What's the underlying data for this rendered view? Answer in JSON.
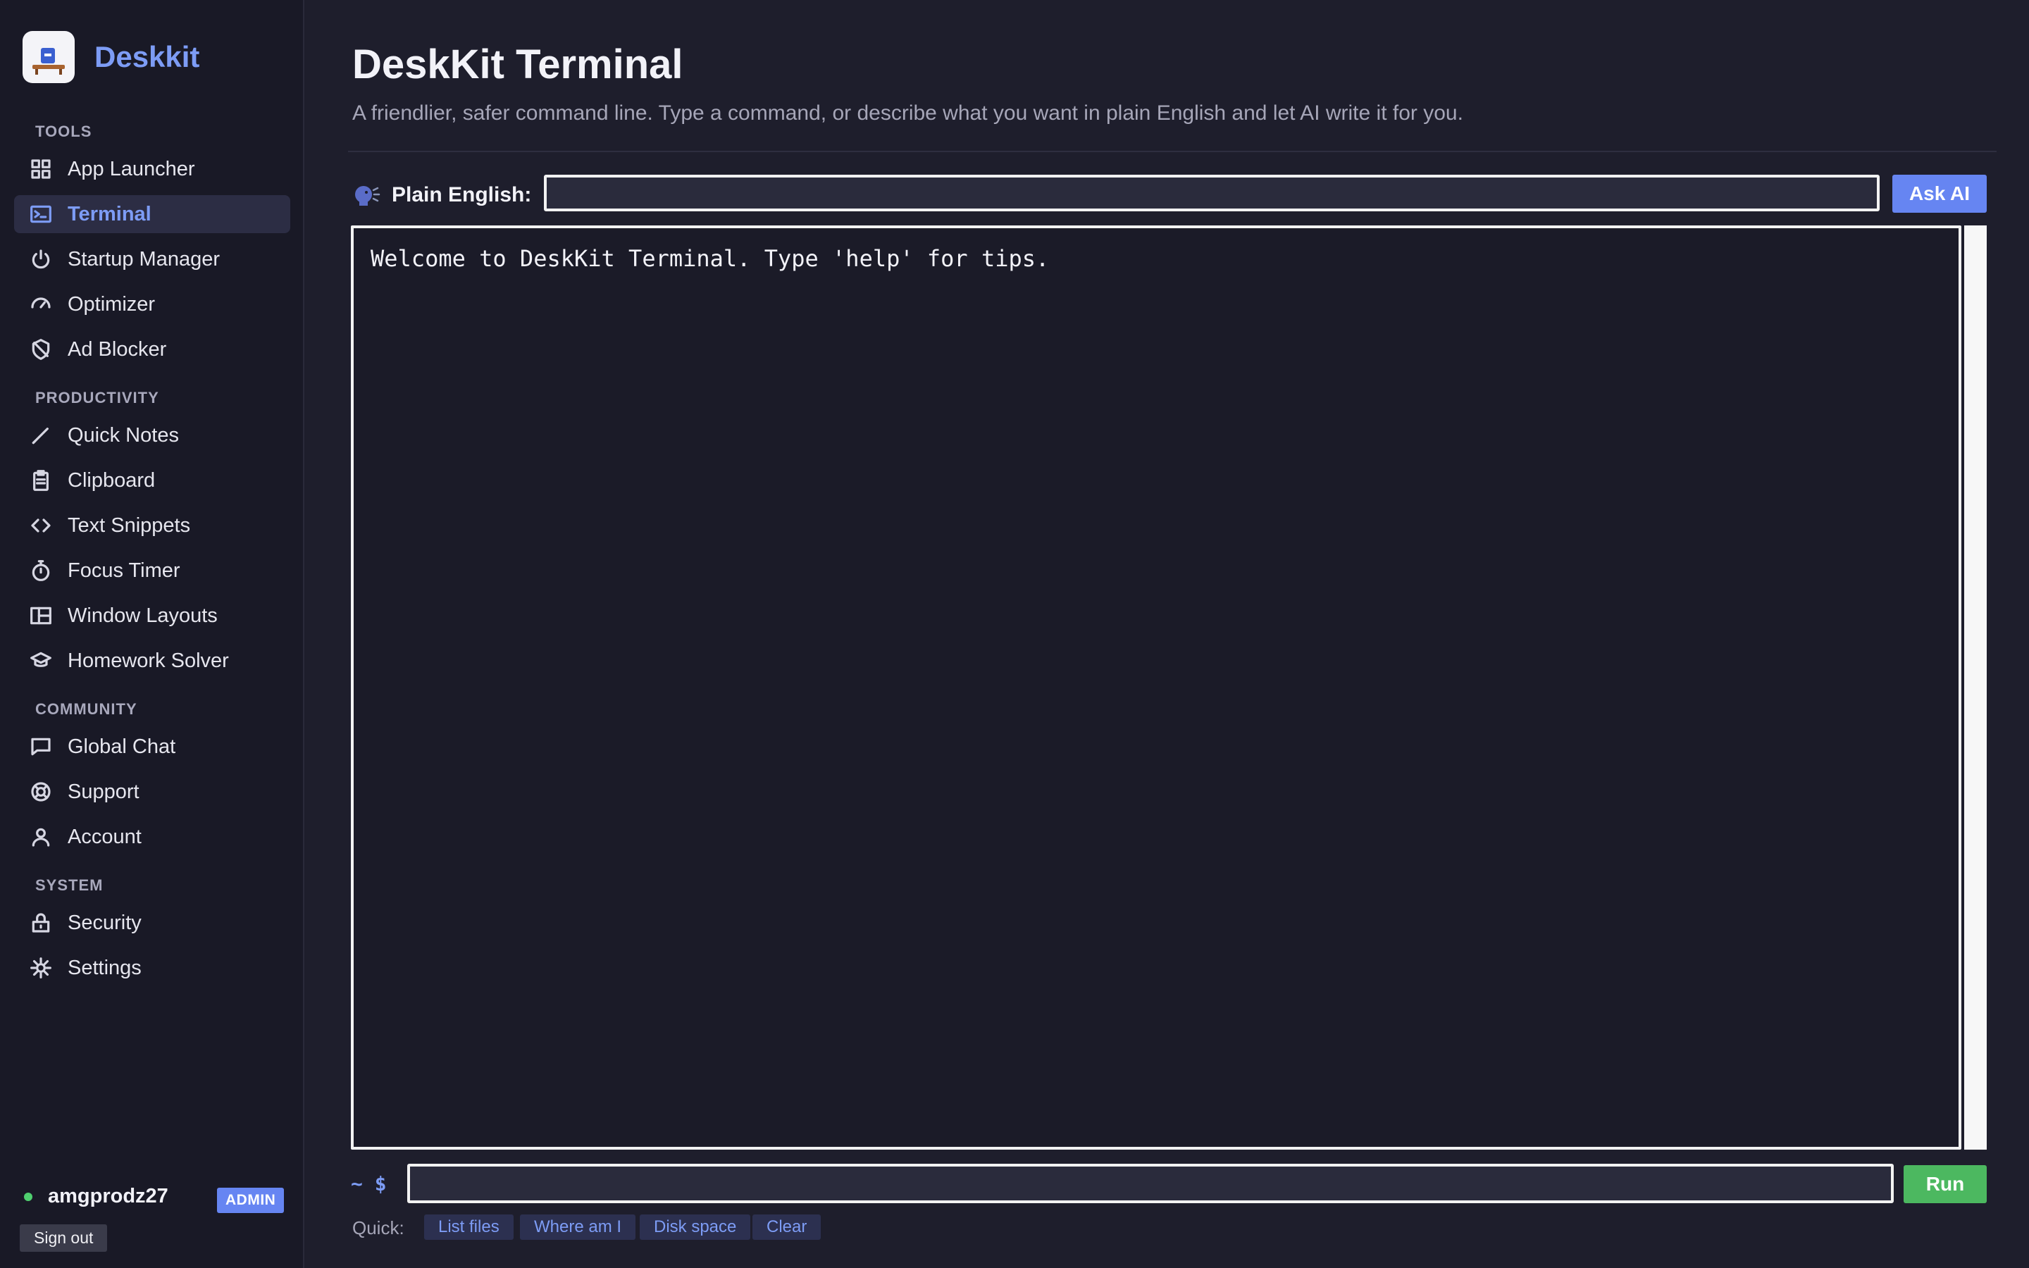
{
  "brand": {
    "name": "Deskkit"
  },
  "sidebar": {
    "sections": [
      {
        "label": "TOOLS"
      },
      {
        "label": "PRODUCTIVITY"
      },
      {
        "label": "COMMUNITY"
      },
      {
        "label": "SYSTEM"
      }
    ],
    "items": [
      {
        "label": "App Launcher",
        "icon": "grid-icon"
      },
      {
        "label": "Terminal",
        "icon": "terminal-icon",
        "active": true
      },
      {
        "label": "Startup Manager",
        "icon": "power-icon"
      },
      {
        "label": "Optimizer",
        "icon": "gauge-icon"
      },
      {
        "label": "Ad Blocker",
        "icon": "shield-block-icon"
      },
      {
        "label": "Quick Notes",
        "icon": "pencil-icon"
      },
      {
        "label": "Clipboard",
        "icon": "clipboard-icon"
      },
      {
        "label": "Text Snippets",
        "icon": "code-icon"
      },
      {
        "label": "Focus Timer",
        "icon": "stopwatch-icon"
      },
      {
        "label": "Window Layouts",
        "icon": "layout-icon"
      },
      {
        "label": "Homework Solver",
        "icon": "graduation-cap-icon"
      },
      {
        "label": "Global Chat",
        "icon": "chat-icon"
      },
      {
        "label": "Support",
        "icon": "lifebuoy-icon"
      },
      {
        "label": "Account",
        "icon": "user-icon"
      },
      {
        "label": "Security",
        "icon": "lock-icon"
      },
      {
        "label": "Settings",
        "icon": "gear-icon"
      }
    ],
    "user": {
      "name": "amgprodz27",
      "badge": "ADMIN",
      "signout_label": "Sign out"
    }
  },
  "main": {
    "title": "DeskKit Terminal",
    "subtitle": "A friendlier, safer command line. Type a command, or describe what you want in plain English and let AI write it for you.",
    "plain_english": {
      "label": "Plain English:",
      "value": "",
      "ask_label": "Ask AI"
    },
    "terminal": {
      "lines": [
        "Welcome to DeskKit Terminal. Type 'help' for tips."
      ]
    },
    "command": {
      "prompt": "~ $",
      "value": "",
      "run_label": "Run"
    },
    "quick": {
      "label": "Quick:",
      "actions": [
        "List files",
        "Where am I",
        "Disk space",
        "Clear"
      ]
    }
  },
  "colors": {
    "accent": "#6685f2",
    "run": "#4cb860",
    "background": "#1e1e2c",
    "sidebar": "#191926"
  }
}
